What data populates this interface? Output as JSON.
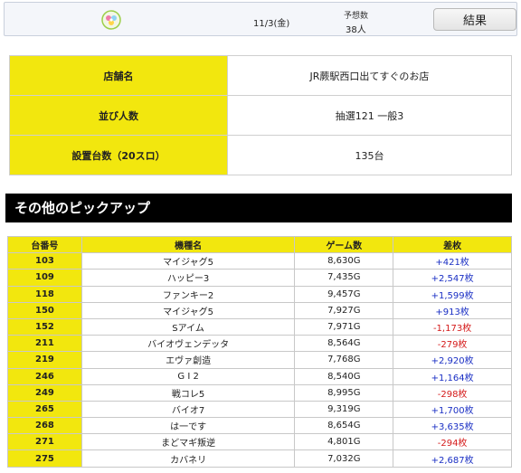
{
  "header": {
    "logo_icon": "pill-flower-logo-icon",
    "date": "11/3(金)",
    "predicted_label": "予想数",
    "predicted_value": "38人",
    "result_button": "結果"
  },
  "info": [
    {
      "label": "店舗名",
      "value": "JR蕨駅西口出てすぐのお店"
    },
    {
      "label": "並び人数",
      "value": "抽選121 一般3"
    },
    {
      "label": "設置台数（20スロ）",
      "value": "135台"
    }
  ],
  "section": {
    "title": "その他のピックアップ"
  },
  "pickup": {
    "headers": [
      "台番号",
      "機種名",
      "ゲーム数",
      "差枚"
    ],
    "rows": [
      {
        "no": "103",
        "machine": "マイジャグ5",
        "games": "8,630G",
        "diff": "+421枚",
        "sign": "pos"
      },
      {
        "no": "109",
        "machine": "ハッピー3",
        "games": "7,435G",
        "diff": "+2,547枚",
        "sign": "pos"
      },
      {
        "no": "118",
        "machine": "ファンキー2",
        "games": "9,457G",
        "diff": "+1,599枚",
        "sign": "pos"
      },
      {
        "no": "150",
        "machine": "マイジャグ5",
        "games": "7,927G",
        "diff": "+913枚",
        "sign": "pos"
      },
      {
        "no": "152",
        "machine": "Sアイム",
        "games": "7,971G",
        "diff": "-1,173枚",
        "sign": "neg"
      },
      {
        "no": "211",
        "machine": "バイオヴェンデッタ",
        "games": "8,564G",
        "diff": "-279枚",
        "sign": "neg"
      },
      {
        "no": "219",
        "machine": "エヴァ創造",
        "games": "7,768G",
        "diff": "+2,920枚",
        "sign": "pos"
      },
      {
        "no": "246",
        "machine": "G I 2",
        "games": "8,540G",
        "diff": "+1,164枚",
        "sign": "pos"
      },
      {
        "no": "249",
        "machine": "戦コレ5",
        "games": "8,995G",
        "diff": "-298枚",
        "sign": "neg"
      },
      {
        "no": "265",
        "machine": "バイオ7",
        "games": "9,319G",
        "diff": "+1,700枚",
        "sign": "pos"
      },
      {
        "no": "268",
        "machine": "は一です",
        "games": "8,654G",
        "diff": "+3,635枚",
        "sign": "pos"
      },
      {
        "no": "271",
        "machine": "まどマギ叛逆",
        "games": "4,801G",
        "diff": "-294枚",
        "sign": "neg"
      },
      {
        "no": "275",
        "machine": "カバネリ",
        "games": "7,032G",
        "diff": "+2,687枚",
        "sign": "pos"
      }
    ]
  },
  "colors": {
    "accent_yellow": "#f2e70e",
    "positive": "#1a2fc4",
    "negative": "#d41a1a",
    "title_bar": "#000000"
  }
}
